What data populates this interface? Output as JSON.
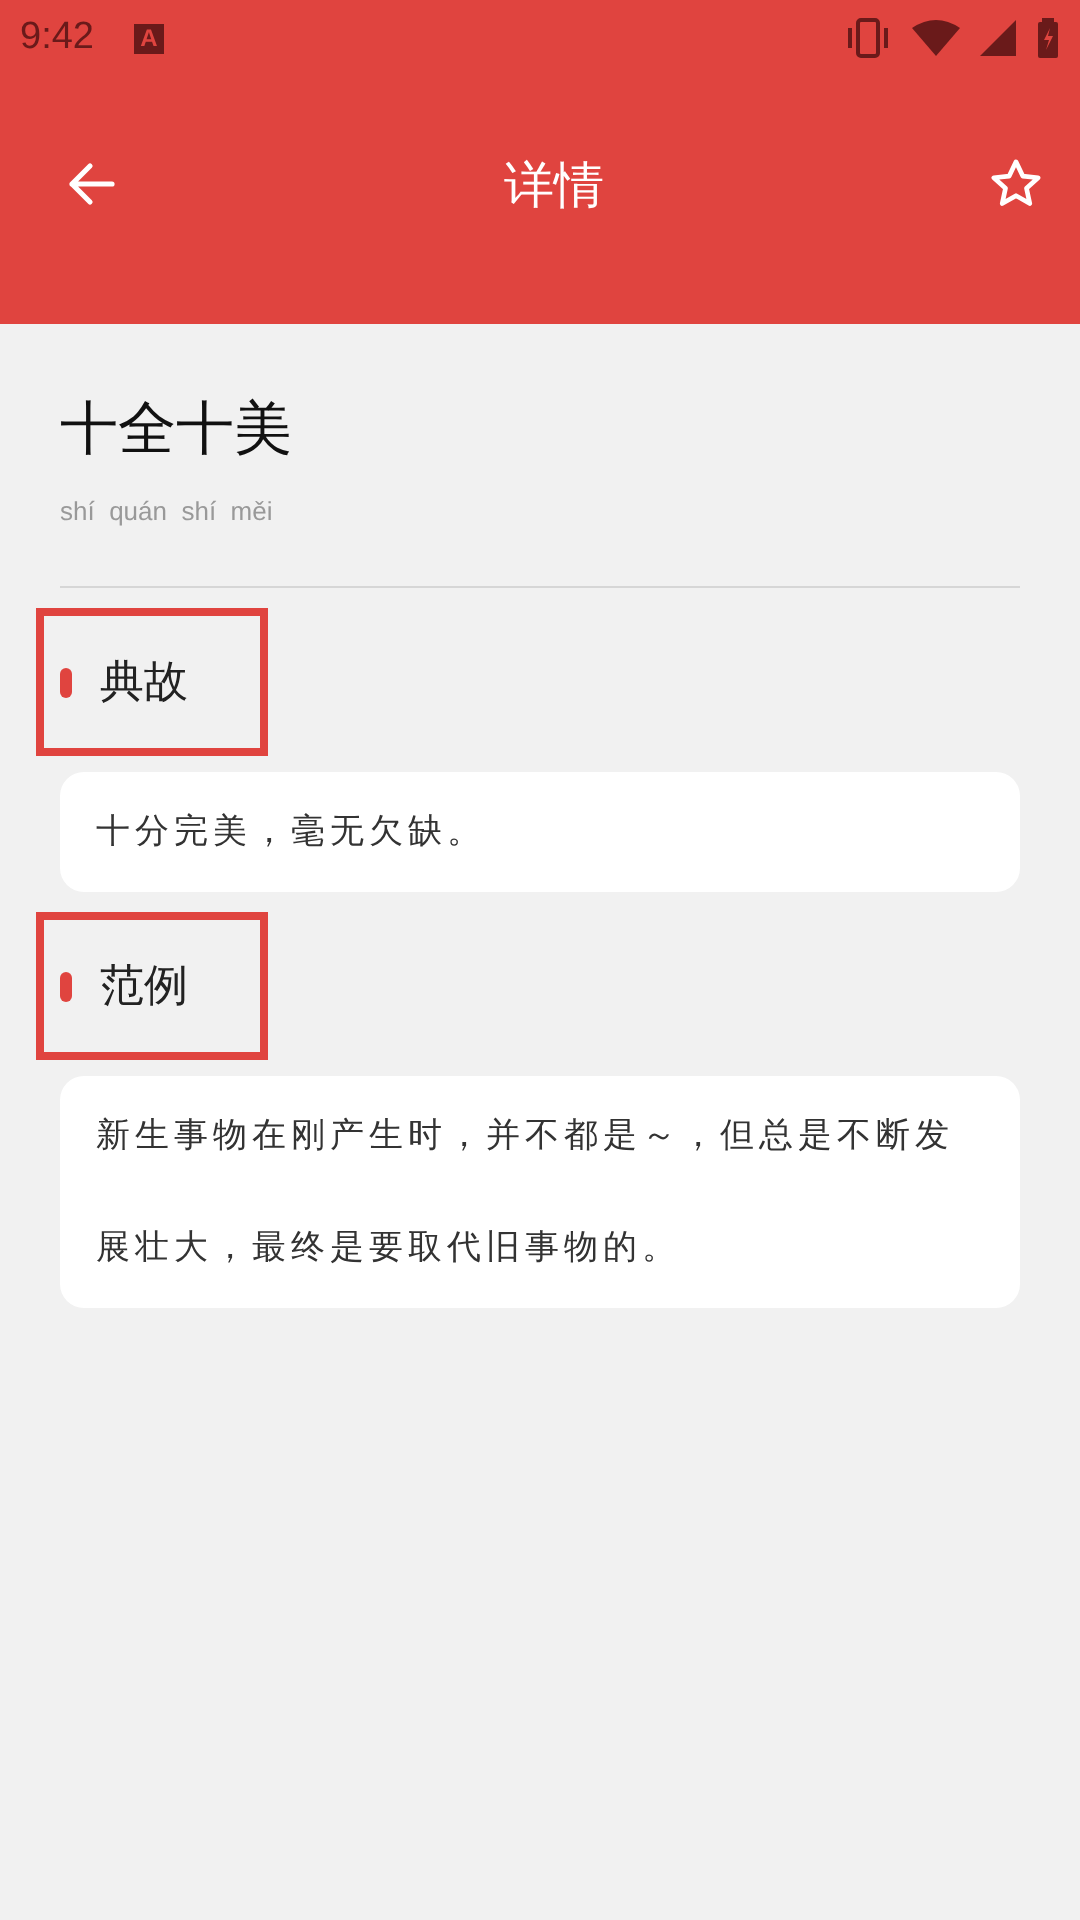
{
  "status_bar": {
    "time": "9:42",
    "notification_icon_text": "A"
  },
  "app_bar": {
    "title": "详情",
    "favorited": false
  },
  "idiom": {
    "title": "十全十美",
    "pinyin": "shí  quán  shí  měi"
  },
  "sections": [
    {
      "heading": "典故",
      "highlighted": true,
      "text": "十分完美，毫无欠缺。"
    },
    {
      "heading": "范例",
      "highlighted": true,
      "text": "新生事物在刚产生时，并不都是～，但总是不断发展壮大，最终是要取代旧事物的。"
    }
  ]
}
